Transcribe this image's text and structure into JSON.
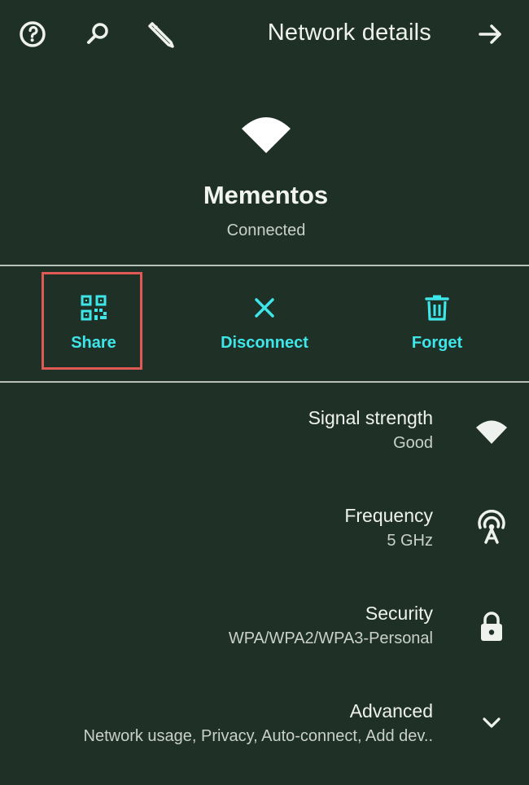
{
  "app_bar": {
    "title": "Network details",
    "icons": [
      "help-icon",
      "search-icon",
      "edit-icon",
      "back-arrow-icon"
    ]
  },
  "network": {
    "name": "Mementos",
    "status": "Connected"
  },
  "actions": [
    {
      "label": "Share",
      "icon": "qr-code-icon"
    },
    {
      "label": "Disconnect",
      "icon": "close-icon"
    },
    {
      "label": "Forget",
      "icon": "trash-icon"
    }
  ],
  "details": [
    {
      "title": "Signal strength",
      "value": "Good",
      "icon": "wifi-icon"
    },
    {
      "title": "Frequency",
      "value": "5 GHz",
      "icon": "antenna-icon"
    },
    {
      "title": "Security",
      "value": "WPA/WPA2/WPA3-Personal",
      "icon": "lock-icon"
    },
    {
      "title": "Advanced",
      "value": "Network usage, Privacy, Auto-connect, Add dev..",
      "icon": "chevron-down-icon"
    }
  ],
  "colors": {
    "background": "#1f3126",
    "accent": "#3ee6ea",
    "highlight": "#e05a55",
    "text": "#eef1ee"
  }
}
